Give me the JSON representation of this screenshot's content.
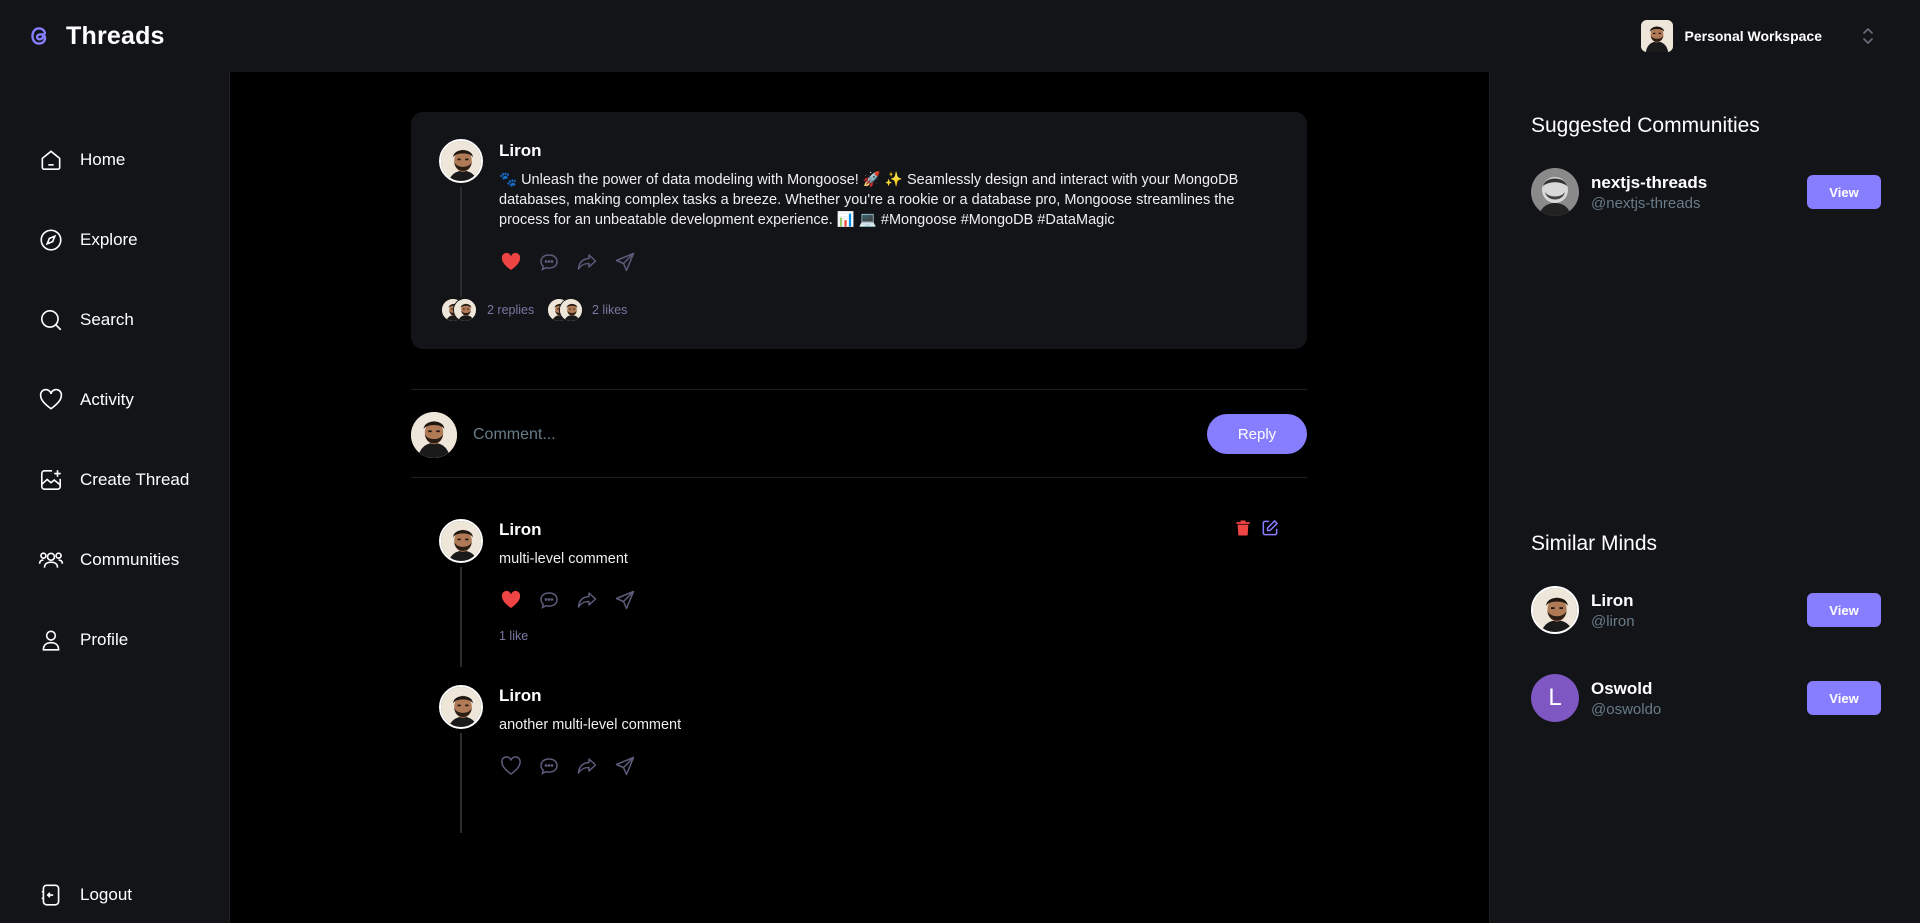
{
  "app": {
    "title": "Threads",
    "accent": "#877eff",
    "like_color": "#ef4444"
  },
  "header": {
    "workspace_label": "Personal Workspace"
  },
  "sidebar": {
    "items": [
      {
        "label": "Home",
        "icon": "home-icon"
      },
      {
        "label": "Explore",
        "icon": "compass-icon"
      },
      {
        "label": "Search",
        "icon": "search-icon"
      },
      {
        "label": "Activity",
        "icon": "heart-icon"
      },
      {
        "label": "Create Thread",
        "icon": "create-image-icon"
      },
      {
        "label": "Communities",
        "icon": "users-icon"
      },
      {
        "label": "Profile",
        "icon": "user-icon"
      }
    ],
    "logout_label": "Logout"
  },
  "thread": {
    "author": "Liron",
    "text": "🐾 Unleash the power of data modeling with Mongoose! 🚀 ✨ Seamlessly design and interact with your MongoDB databases, making complex tasks a breeze. Whether you're a rookie or a database pro, Mongoose streamlines the process for an unbeatable development experience. 📊 💻 #Mongoose #MongoDB #DataMagic",
    "replies_label": "2 replies",
    "likes_label": "2 likes",
    "liked": true
  },
  "comment_form": {
    "placeholder": "Comment...",
    "submit_label": "Reply"
  },
  "comments": [
    {
      "author": "Liron",
      "text": "multi-level comment",
      "likes_label": "1 like",
      "liked": true
    },
    {
      "author": "Liron",
      "text": "another multi-level comment",
      "liked": false
    }
  ],
  "right_sidebar": {
    "communities_title": "Suggested Communities",
    "communities": [
      {
        "name": "nextjs-threads",
        "handle": "@nextjs-threads",
        "action": "View"
      }
    ],
    "users_title": "Similar Minds",
    "users": [
      {
        "name": "Liron",
        "handle": "@liron",
        "action": "View"
      },
      {
        "name": "Oswold",
        "handle": "@oswoldo",
        "action": "View",
        "initial": "L",
        "avatar_color": "#7e57c2"
      }
    ]
  }
}
